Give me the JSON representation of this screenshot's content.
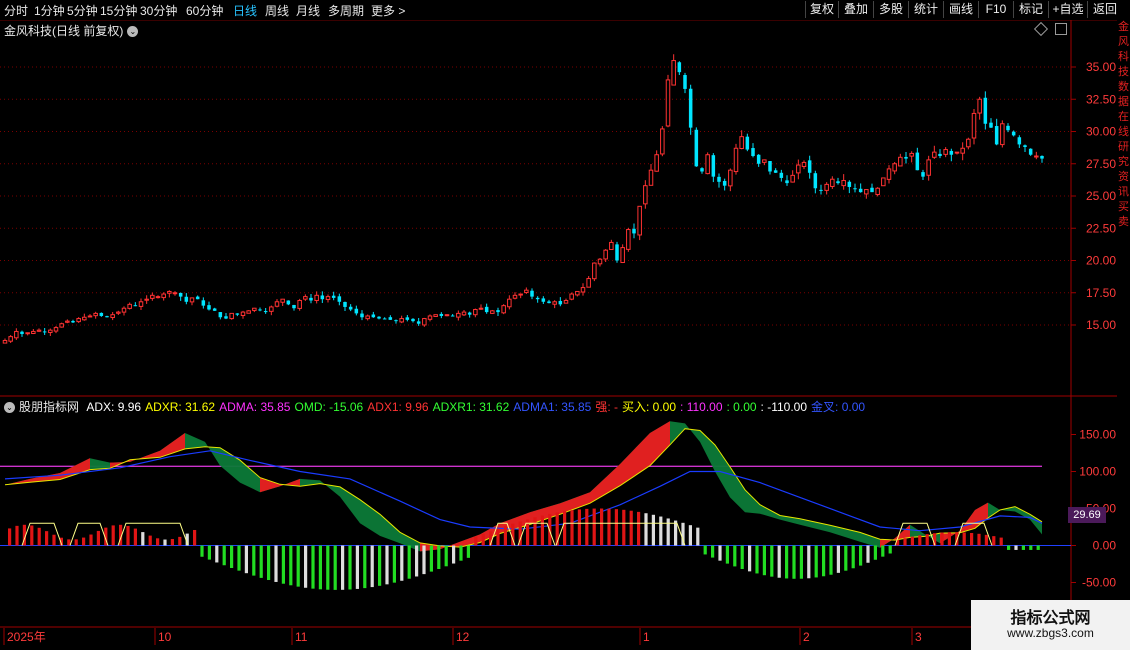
{
  "toolbar": {
    "periods": [
      "分时",
      "1分钟",
      "5分钟",
      "15分钟",
      "30分钟",
      "60分钟",
      "日线",
      "周线",
      "月线",
      "多周期",
      "更多 >"
    ],
    "active_period": "日线",
    "tools": [
      "复权",
      "叠加",
      "多股",
      "统计",
      "画线",
      "F10",
      "标记",
      "+自选",
      "返回"
    ]
  },
  "main_title": "金风科技(日线 前复权)",
  "price_axis": {
    "ticks": [
      "35.00",
      "32.50",
      "30.00",
      "27.50",
      "25.00",
      "22.50",
      "20.00",
      "17.50",
      "15.00"
    ]
  },
  "indicator": {
    "name": "股朋指标网",
    "items": [
      {
        "text": "ADX: 9.96",
        "color": "#ffffff"
      },
      {
        "text": "ADXR: 31.62",
        "color": "#ffff00"
      },
      {
        "text": "ADMA: 35.85",
        "color": "#ff33ff"
      },
      {
        "text": "OMD: -15.06",
        "color": "#33ff33"
      },
      {
        "text": "ADX1: 9.96",
        "color": "#ff3333"
      },
      {
        "text": "ADXR1: 31.62",
        "color": "#33ff33"
      },
      {
        "text": "ADMA1: 35.85",
        "color": "#3355ff"
      },
      {
        "text": "强: -",
        "color": "#ff3333"
      },
      {
        "text": "买入: 0.00",
        "color": "#ffff00"
      },
      {
        "text": ": 110.00",
        "color": "#ff33ff"
      },
      {
        "text": ": 0.00",
        "color": "#33ff33"
      },
      {
        "text": ": -110.00",
        "color": "#ffffff"
      },
      {
        "text": "金叉: 0.00",
        "color": "#3355ff"
      }
    ],
    "axis_ticks": [
      "150.00",
      "100.00",
      "50.00",
      "0.00",
      "-50.00"
    ],
    "current_value": "29.69",
    "current_value_color": "#4b1a5a"
  },
  "date_axis": {
    "labels": [
      "2025年",
      "10",
      "11",
      "12",
      "1",
      "2",
      "3"
    ]
  },
  "right_panel_chars": "金风科技数据在线研究资讯买卖",
  "colors": {
    "up": "#ff3232",
    "down": "#00e5ff",
    "grid": "#7a0000",
    "axis_text": "#ff3b3b"
  },
  "watermark": {
    "line1": "指标公式网",
    "line2": "www.zbgs3.com"
  }
}
